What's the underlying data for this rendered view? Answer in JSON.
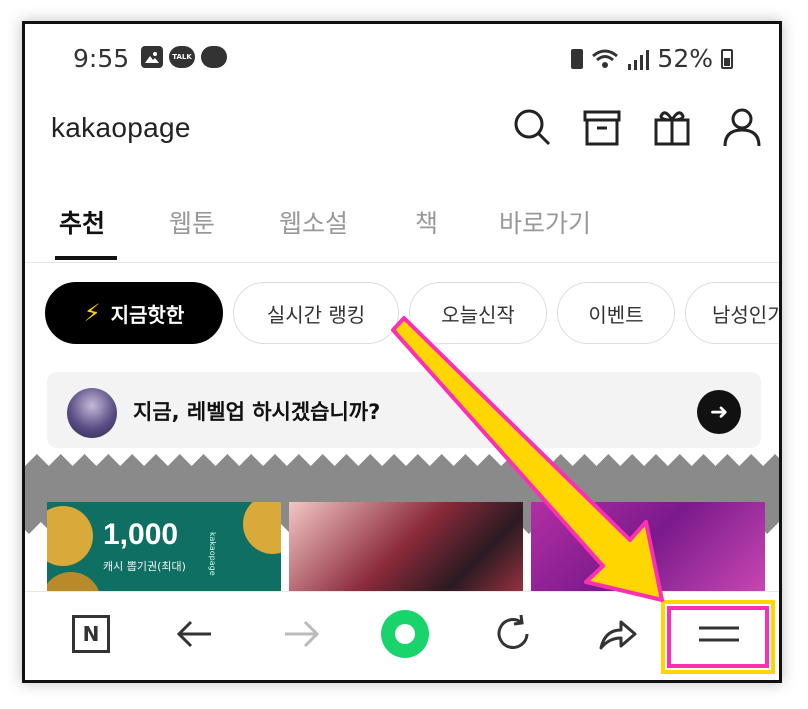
{
  "status_bar": {
    "time": "9:55",
    "talk_label": "TALK",
    "battery": "52%"
  },
  "header": {
    "logo": "kakaopage",
    "icons": [
      "search-icon",
      "archive-icon",
      "gift-icon",
      "profile-icon"
    ]
  },
  "tabs": [
    {
      "label": "추천",
      "active": true
    },
    {
      "label": "웹툰",
      "active": false
    },
    {
      "label": "웹소설",
      "active": false
    },
    {
      "label": "책",
      "active": false
    },
    {
      "label": "바로가기",
      "active": false
    }
  ],
  "chips": [
    {
      "label": "지금핫한",
      "active": true
    },
    {
      "label": "실시간 랭킹",
      "active": false
    },
    {
      "label": "오늘신작",
      "active": false
    },
    {
      "label": "이벤트",
      "active": false
    },
    {
      "label": "남성인기",
      "active": false
    }
  ],
  "banner": {
    "text": "지금, 레벨업 하시겠습니까?"
  },
  "thumbs": {
    "cash_amount": "1,000",
    "cash_sub": "캐시 뽑기권(최대)",
    "brand_vertical": "kakaopage"
  },
  "bottom_nav": {
    "n_label": "N",
    "items": [
      "naver-n-icon",
      "back-arrow-icon",
      "forward-arrow-icon",
      "home-circle-icon",
      "reload-icon",
      "share-icon",
      "menu-icon"
    ]
  },
  "colors": {
    "chip_active_bg": "#000000",
    "bolt": "#ffd400",
    "highlight_border": "#ffd600",
    "highlight_inner": "#ff2fb4",
    "arrow_fill": "#ffd600",
    "arrow_stroke": "#ff2fb4",
    "home_circle": "#19d36b"
  }
}
